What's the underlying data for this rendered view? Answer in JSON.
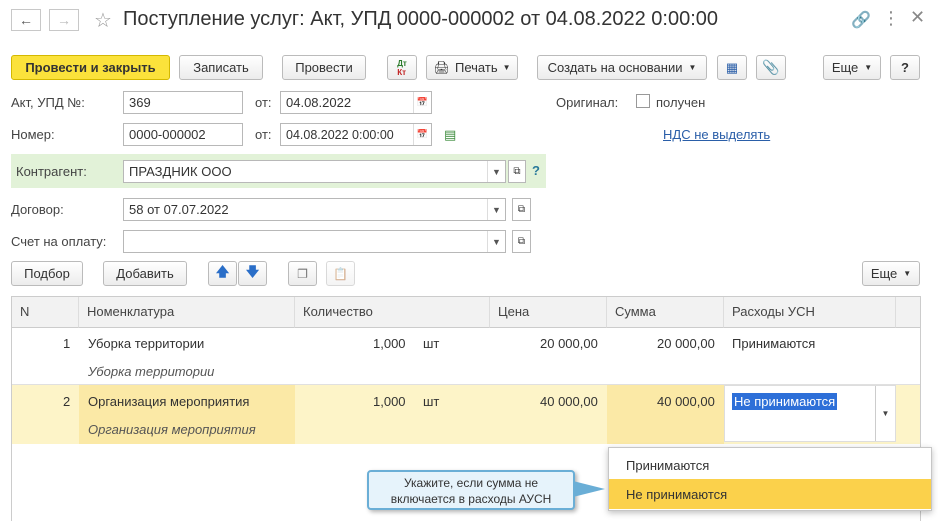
{
  "window": {
    "title": "Поступление услуг: Акт, УПД 0000-000002 от 04.08.2022 0:00:00"
  },
  "toolbar": {
    "post_close": "Провести и закрыть",
    "save": "Записать",
    "post": "Провести",
    "dt_kt_dt": "Дт",
    "dt_kt_kt": "Кт",
    "print": "Печать",
    "create_based": "Создать на основании",
    "more": "Еще",
    "help": "?"
  },
  "form": {
    "act_label": "Акт, УПД №:",
    "act_value": "369",
    "from_label": "от:",
    "act_date": "04.08.2022",
    "number_label": "Номер:",
    "number_value": "0000-000002",
    "number_date": "04.08.2022  0:00:00",
    "original_label": "Оригинал:",
    "original_checkbox": "получен",
    "vat_link": "НДС не выделять",
    "counterparty_label": "Контрагент:",
    "counterparty_value": "ПРАЗДНИК ООО",
    "counterparty_help": "?",
    "contract_label": "Договор:",
    "contract_value": "58 от 07.07.2022",
    "invoice_label": "Счет на оплату:",
    "invoice_value": ""
  },
  "table_toolbar": {
    "pick": "Подбор",
    "add": "Добавить",
    "more": "Еще"
  },
  "table": {
    "headers": [
      "N",
      "Номенклатура",
      "Количество",
      "Цена",
      "Сумма",
      "Расходы УСН"
    ],
    "rows": [
      {
        "n": "1",
        "name": "Уборка территории",
        "name_sub": "Уборка территории",
        "qty": "1,000",
        "unit": "шт",
        "price": "20 000,00",
        "sum": "20 000,00",
        "usn": "Принимаются"
      },
      {
        "n": "2",
        "name": "Организация мероприятия",
        "name_sub": "Организация мероприятия",
        "qty": "1,000",
        "unit": "шт",
        "price": "40 000,00",
        "sum": "40 000,00",
        "usn": "Не принимаются"
      }
    ]
  },
  "dropdown": {
    "options": [
      "Принимаются",
      "Не принимаются"
    ],
    "selected": "Не принимаются"
  },
  "tooltip": {
    "line1": "Укажите, если сумма не",
    "line2": "включается в расходы АУСН"
  },
  "colors": {
    "primary_button": "#fbe23b",
    "selected_row": "#fdf4c8",
    "selected_cell": "#fbe9a6",
    "selection_blue": "#2d6fd8",
    "counterparty_bg": "#e2f2d8",
    "dropdown_highlight": "#fbd14b"
  }
}
